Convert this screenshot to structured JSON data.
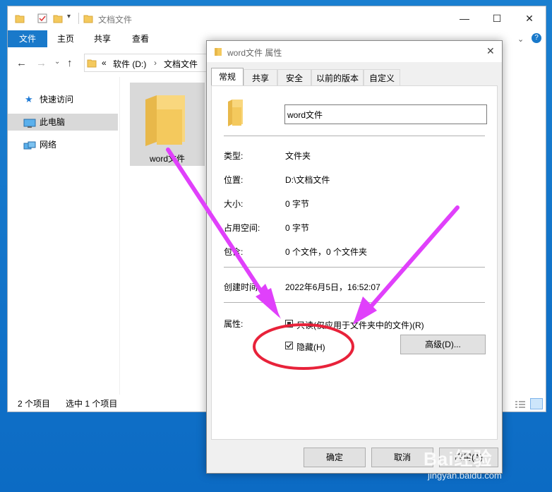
{
  "explorer": {
    "title": "文档文件",
    "ribbon_tabs": [
      "文件",
      "主页",
      "共享",
      "查看"
    ],
    "address": {
      "prefix": "«",
      "drive": "软件 (D:)",
      "folder": "文档文件"
    },
    "sidebar": [
      {
        "label": "快速访问",
        "icon": "star-icon"
      },
      {
        "label": "此电脑",
        "icon": "computer-icon"
      },
      {
        "label": "网络",
        "icon": "network-icon"
      }
    ],
    "file": {
      "name": "word文件"
    },
    "status_left": "2 个项目",
    "status_selected": "选中 1 个项目"
  },
  "dialog": {
    "title": "word文件 属性",
    "tabs": [
      "常规",
      "共享",
      "安全",
      "以前的版本",
      "自定义"
    ],
    "name_value": "word文件",
    "rows": {
      "type_label": "类型:",
      "type_value": "文件夹",
      "location_label": "位置:",
      "location_value": "D:\\文档文件",
      "size_label": "大小:",
      "size_value": "0 字节",
      "disk_label": "占用空间:",
      "disk_value": "0 字节",
      "contains_label": "包含:",
      "contains_value": "0 个文件，0 个文件夹",
      "created_label": "创建时间:",
      "created_value": "2022年6月5日，16:52:07"
    },
    "attributes_label": "属性:",
    "readonly_label": "只读(仅应用于文件夹中的文件)(R)",
    "hidden_label": "隐藏(H)",
    "advanced_label": "高级(D)...",
    "ok_label": "确定",
    "cancel_label": "取消",
    "apply_label": "应用(A)"
  },
  "watermark": {
    "brand": "Bai经验",
    "url": "jingyan.baidu.com"
  },
  "colors": {
    "accent": "#1979ca",
    "annotation": "#e8223a",
    "arrow": "#e040fb"
  }
}
